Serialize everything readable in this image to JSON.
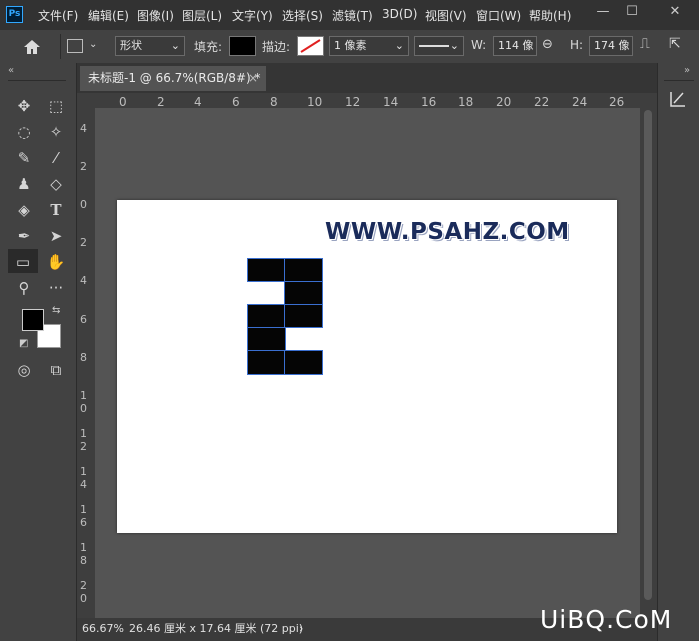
{
  "app": {
    "logo": "Ps"
  },
  "menu": [
    "文件(F)",
    "编辑(E)",
    "图像(I)",
    "图层(L)",
    "文字(Y)",
    "选择(S)",
    "滤镜(T)",
    "3D(D)",
    "视图(V)",
    "窗口(W)",
    "帮助(H)"
  ],
  "window_controls": {
    "minimize": "—",
    "restore": "☐",
    "close": "✕"
  },
  "options": {
    "mode_value": "形状",
    "fill_label": "填充:",
    "stroke_label": "描边:",
    "stroke_width": "1 像素",
    "w_label": "W:",
    "w_value": "114 像",
    "h_label": "H:",
    "h_value": "174 像",
    "fill_color": "#000000"
  },
  "tab": {
    "title": "未标题-1 @ 66.7%(RGB/8#) *",
    "close": "×"
  },
  "ruler_h": [
    "0",
    "2",
    "4",
    "6",
    "8",
    "10",
    "12",
    "14",
    "16",
    "18",
    "20",
    "22",
    "24",
    "26"
  ],
  "ruler_v": [
    "4",
    "2",
    "0",
    "2",
    "4",
    "6",
    "8",
    "1",
    "0",
    "1",
    "2",
    "1",
    "4",
    "1",
    "6",
    "1",
    "8",
    "2",
    "0"
  ],
  "watermark_text": "WWW.PSAHZ.COM",
  "status": {
    "zoom": "66.67%",
    "doc_size": "26.46 厘米 x 17.64 厘米 (72 ppi)",
    "arrow": "›"
  },
  "footer_watermark": "UiBQ.CoM",
  "colors": {
    "foreground": "#000000",
    "background": "#ffffff",
    "accent": "#31a8ff"
  }
}
